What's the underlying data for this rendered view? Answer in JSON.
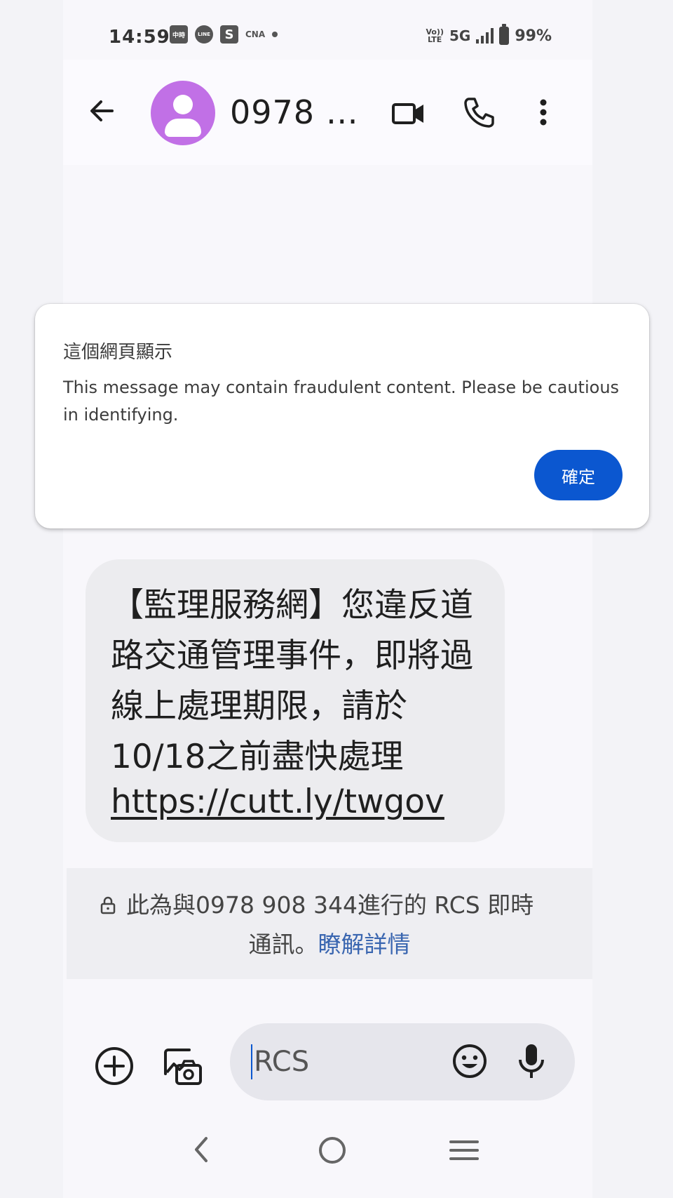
{
  "status_bar": {
    "time": "14:59",
    "network": "5G",
    "volte_top": "Vo))",
    "volte_bottom": "LTE",
    "battery": "99%",
    "notification_icons": [
      "news-icon",
      "line-icon",
      "s-app-icon",
      "cna-icon"
    ],
    "notif_labels": [
      "中時",
      "LINE",
      "S",
      "CNA"
    ]
  },
  "header": {
    "contact": "0978 …",
    "avatar_color": "#c170e6"
  },
  "dialog": {
    "title": "這個網頁顯示",
    "message": "This message may contain fraudulent content. Please be cautious in identifying.",
    "ok_label": "確定",
    "button_color": "#0b57d0"
  },
  "message": {
    "text": "【監理服務網】您違反道路交通管理事件，即將過線上處理期限，請於10/18之前盡快處理",
    "link": "https://cutt.ly/twgov"
  },
  "rcs_info": {
    "text": "此為與0978 908 344進行的 RCS 即時",
    "text2": "通訊。",
    "link": "瞭解詳情"
  },
  "composer": {
    "placeholder": "RCS"
  }
}
